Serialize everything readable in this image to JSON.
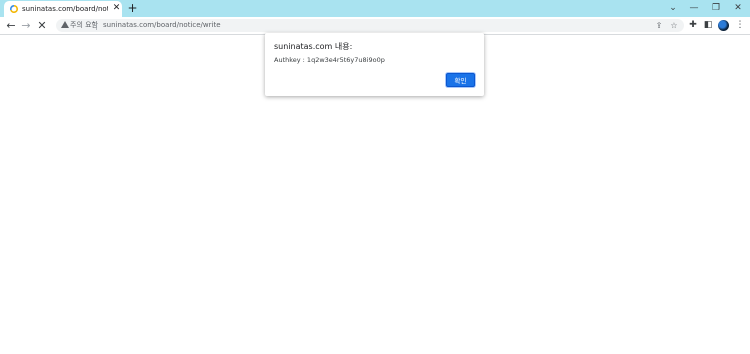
{
  "browser": {
    "tab": {
      "title": "suninatas.com/board/notice/wr",
      "close_glyph": "✕",
      "favicon": "loading-spinner-icon"
    },
    "new_tab_glyph": "+",
    "window_controls": {
      "tab_search_glyph": "⌄",
      "minimize_glyph": "—",
      "restore_glyph": "❐",
      "close_glyph": "✕"
    },
    "toolbar": {
      "back_glyph": "←",
      "forward_glyph": "→",
      "stop_glyph": "✕",
      "security_label": "주의 요함",
      "url": "suninatas.com/board/notice/write",
      "share_glyph": "⇪",
      "bookmark_glyph": "☆",
      "extensions_glyph": "✚",
      "sidepanel_glyph": "◧",
      "menu_glyph": "⋮"
    },
    "colors": {
      "tabbar_bg": "#a9e3f0",
      "accent": "#1a73e8"
    }
  },
  "dialog": {
    "title": "suninatas.com 내용:",
    "message": "Authkey : 1q2w3e4r5t6y7u8i9o0p",
    "ok_label": "확인"
  }
}
